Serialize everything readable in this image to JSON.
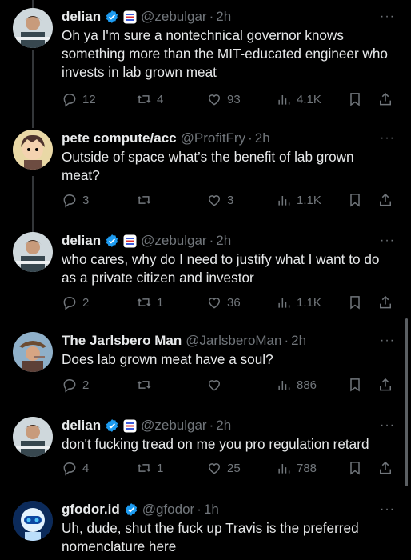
{
  "tweets": [
    {
      "name": "delian",
      "verified": true,
      "has_flag": true,
      "handle": "@zebulgar",
      "time": "2h",
      "text": "Oh ya I'm sure a nontechnical governor knows something more than the MIT-educated engineer who invests in lab grown meat",
      "replies": "12",
      "reposts": "4",
      "likes": "93",
      "views": "4.1K"
    },
    {
      "name": "pete compute/acc",
      "verified": false,
      "has_flag": false,
      "handle": "@ProfitFry",
      "time": "2h",
      "text": "Outside of space what’s the benefit of lab grown meat?",
      "replies": "3",
      "reposts": "",
      "likes": "3",
      "views": "1.1K"
    },
    {
      "name": "delian",
      "verified": true,
      "has_flag": true,
      "handle": "@zebulgar",
      "time": "2h",
      "text": "who cares, why do I need to justify what I want to do as a private citizen and investor",
      "replies": "2",
      "reposts": "1",
      "likes": "36",
      "views": "1.1K"
    },
    {
      "name": "The Jarlsbero Man",
      "verified": false,
      "has_flag": false,
      "handle": "@JarlsberoMan",
      "time": "2h",
      "text": "Does lab grown meat have a soul?",
      "replies": "2",
      "reposts": "",
      "likes": "",
      "views": "886"
    },
    {
      "name": "delian",
      "verified": true,
      "has_flag": true,
      "handle": "@zebulgar",
      "time": "2h",
      "text": "don't fucking tread on me you pro regulation retard",
      "replies": "4",
      "reposts": "1",
      "likes": "25",
      "views": "788"
    },
    {
      "name": "gfodor.id",
      "verified": true,
      "has_flag": false,
      "handle": "@gfodor",
      "time": "1h",
      "text": "Uh, dude, shut the fuck up Travis is the preferred nomenclature here",
      "replies": "",
      "reposts": "",
      "likes": "",
      "views": ""
    }
  ],
  "ui": {
    "dot": "·",
    "more": "···"
  },
  "colors": {
    "background": "#000000",
    "text": "#e7e9ea",
    "muted": "#71767b",
    "verified": "#1d9bf0"
  },
  "icons": [
    "reply-icon",
    "repost-icon",
    "like-icon",
    "views-icon",
    "bookmark-icon",
    "share-icon",
    "verified-badge-icon",
    "flag-badge-icon",
    "more-icon"
  ]
}
